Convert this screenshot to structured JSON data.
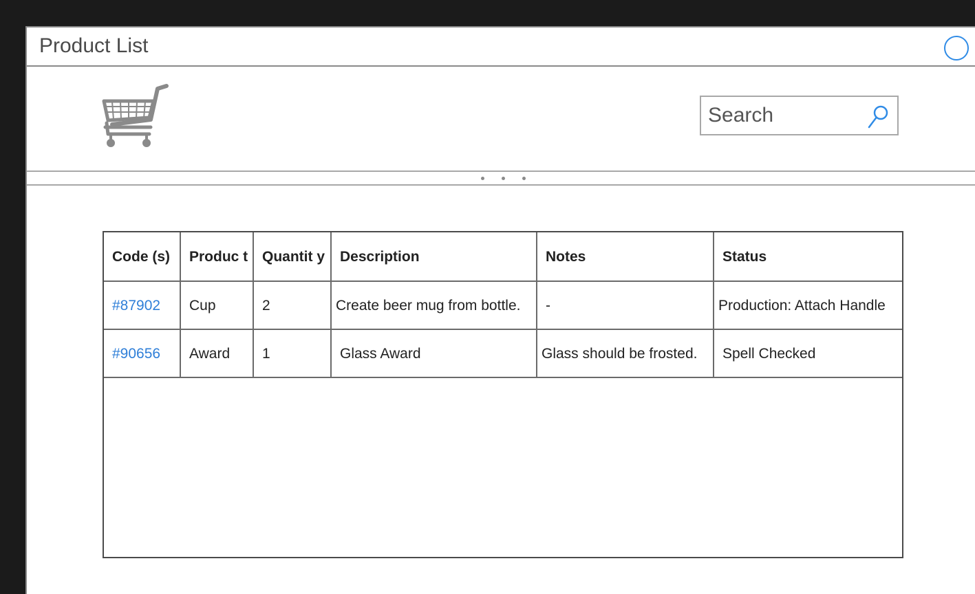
{
  "window": {
    "title": "Product List"
  },
  "header": {
    "cart_icon": "shopping-cart-icon",
    "search": {
      "placeholder": "Search",
      "icon": "search-icon"
    }
  },
  "table": {
    "columns": [
      "Code (s)",
      "Produc t",
      "Quantit y",
      "Description",
      "Notes",
      "Status"
    ],
    "rows": [
      {
        "code": "#87902",
        "product": "Cup",
        "quantity": "2",
        "description": "Create beer mug from bottle.",
        "notes": "-",
        "status": "Production: Attach Handle"
      },
      {
        "code": "#90656",
        "product": "Award",
        "quantity": "1",
        "description": "Glass Award",
        "notes": "Glass should be frosted.",
        "status": "Spell Checked"
      }
    ]
  },
  "colors": {
    "accent": "#2f8be6",
    "link": "#2f7fd8",
    "border": "#8a8a8a",
    "background": "#1b1b1b"
  }
}
